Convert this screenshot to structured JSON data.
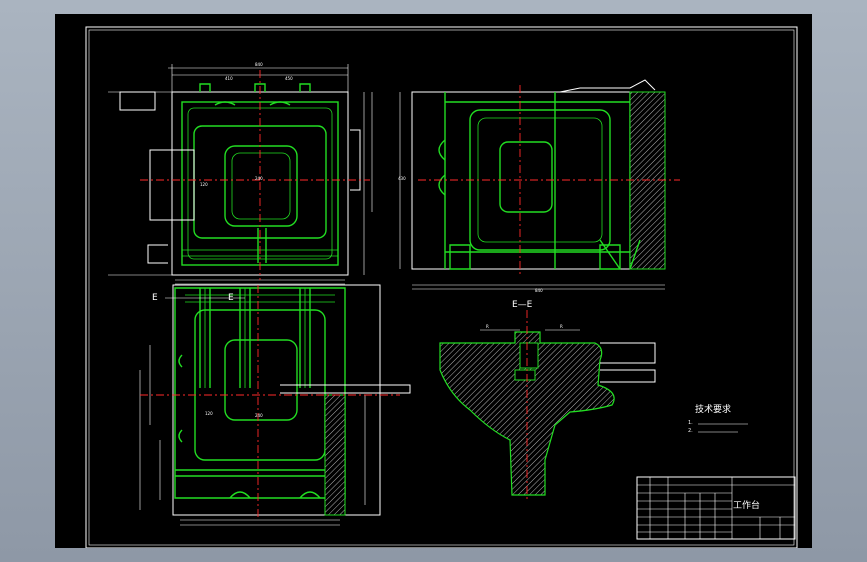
{
  "drawing": {
    "section_label": "E—E",
    "section_marker_left": "E",
    "section_marker_right": "E",
    "tech_title": "技术要求",
    "tech_notes": [
      "1.",
      "2."
    ],
    "title_block": {
      "part_name": "工作台"
    }
  },
  "colors": {
    "outline": "#ffffff",
    "part": "#22dd22",
    "centerline": "#ff2a2a",
    "background": "#000000"
  }
}
